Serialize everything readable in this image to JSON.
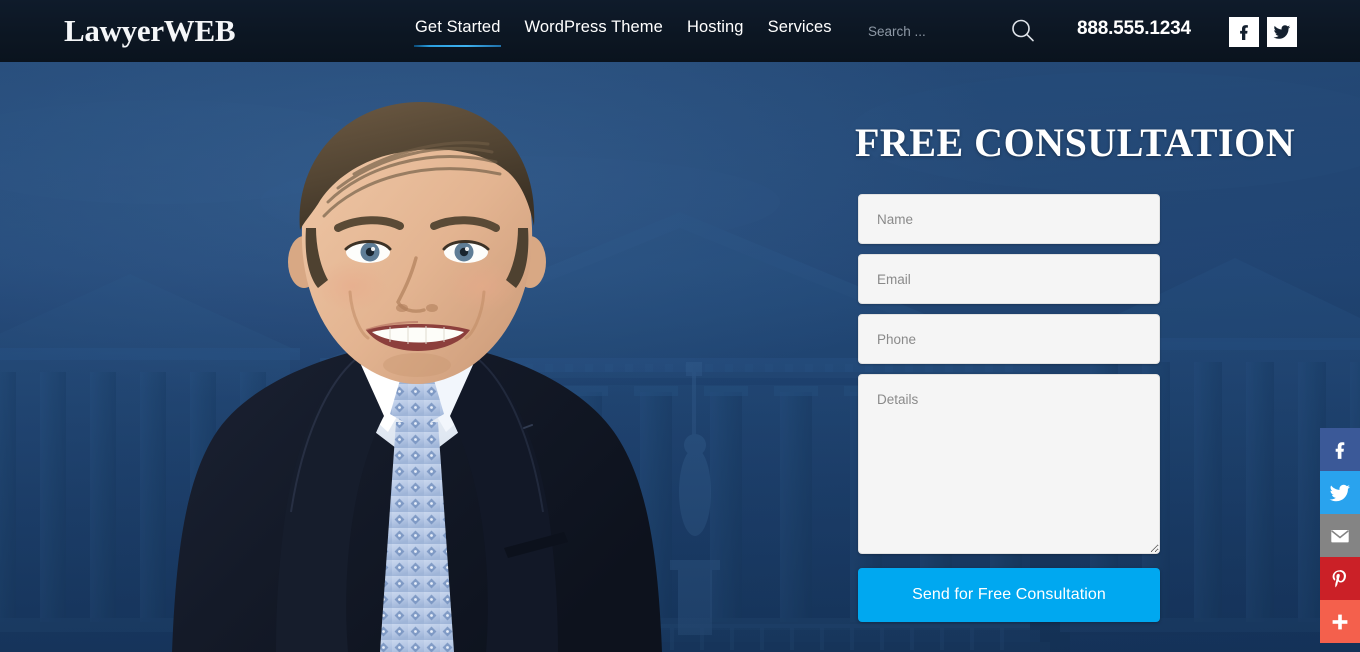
{
  "header": {
    "logo": "LawyerWEB",
    "nav": [
      {
        "label": "Get Started",
        "active": true
      },
      {
        "label": "WordPress Theme",
        "active": false
      },
      {
        "label": "Hosting",
        "active": false
      },
      {
        "label": "Services",
        "active": false
      }
    ],
    "search": {
      "value": "",
      "placeholder": "Search ..."
    },
    "phone": "888.555.1234",
    "social": [
      {
        "name": "facebook",
        "glyph": "f"
      },
      {
        "name": "twitter",
        "glyph": "t"
      }
    ],
    "colors": {
      "background": "#0c1622",
      "active_underline": "#3fb2ef",
      "text": "#ffffff"
    }
  },
  "hero": {
    "title": "FREE CONSULTATION",
    "background_description": "courthouse",
    "portrait_description": "lawyer-portrait",
    "colors": {
      "background": "#1f4573",
      "highlight": "#2c5384"
    }
  },
  "form": {
    "fields": [
      {
        "name": "name",
        "placeholder": "Name",
        "value": "",
        "type": "text"
      },
      {
        "name": "email",
        "placeholder": "Email",
        "value": "",
        "type": "text"
      },
      {
        "name": "phone",
        "placeholder": "Phone",
        "value": "",
        "type": "text"
      }
    ],
    "details": {
      "placeholder": "Details",
      "value": ""
    },
    "submit_label": "Send for Free Consultation",
    "colors": {
      "submit": "#00a8f0",
      "field_bg": "#f5f5f5",
      "placeholder": "#8a8a8a"
    }
  },
  "share_bar": [
    {
      "name": "facebook",
      "color": "#3b5998"
    },
    {
      "name": "twitter",
      "color": "#29a3ee"
    },
    {
      "name": "email",
      "color": "#848484"
    },
    {
      "name": "pinterest",
      "color": "#cb2027"
    },
    {
      "name": "addthis",
      "color": "#f4604c"
    }
  ]
}
